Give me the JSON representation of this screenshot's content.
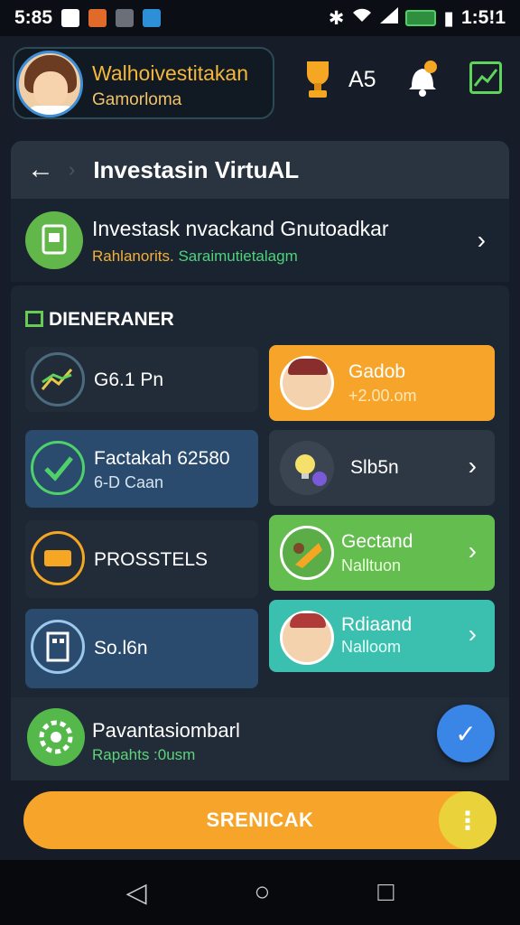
{
  "status_bar": {
    "time": "5:85",
    "clock": "1:5!1",
    "icons": [
      "notification-icon",
      "app-icon",
      "gallery-icon",
      "sync-icon",
      "bluetooth-icon",
      "wifi-icon",
      "signal-icon",
      "battery-icon"
    ]
  },
  "header": {
    "username": "Walhoivestitakan",
    "subtitle": "Gamorloma",
    "score": "A5",
    "icons": [
      "trophy-icon",
      "bell-icon",
      "chart-icon"
    ]
  },
  "titlebar": {
    "back": "←",
    "title": "Investasin VirtuAL"
  },
  "info": {
    "title": "Investask nvackand Gnutoadkar",
    "sub_a": "Rahlanorits.",
    "sub_b": "Saraimutietalagm"
  },
  "section": {
    "label": "DIENERANER"
  },
  "cards": [
    {
      "title": "G6.1 Pn",
      "sub": ""
    },
    {
      "title": "Gadob",
      "sub": "+2.00.om"
    },
    {
      "title": "Factakah 62580",
      "sub": "6-D Caan"
    },
    {
      "title": "Slb5n",
      "sub": ""
    },
    {
      "title": "PROSSTELS",
      "sub": ""
    },
    {
      "title": "Gectand",
      "sub": "Nalltuon"
    },
    {
      "title": "So.l6n",
      "sub": ""
    },
    {
      "title": "Rdiaand",
      "sub": "Nalloom"
    }
  ],
  "bottom": {
    "title": "Pavantasiombarl",
    "sub": "Rapahts :0usm"
  },
  "cta": {
    "label": "SRENICAK"
  },
  "colors": {
    "orange": "#f7a52a",
    "green": "#64bd4f",
    "teal": "#3bbfae",
    "blue_card": "#2a4b6d",
    "fab": "#3a86e6"
  }
}
